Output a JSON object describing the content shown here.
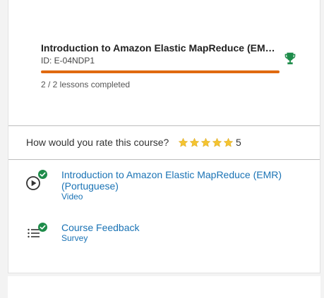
{
  "course": {
    "title": "Introduction to Amazon Elastic MapReduce (EMR) (Portuguese)",
    "id_label": "ID: E-04NDP1",
    "progress_fraction": 1.0,
    "lessons_completed": "2 / 2 lessons completed",
    "trophy_icon": "trophy-icon"
  },
  "rating": {
    "question": "How would you rate this course?",
    "stars": 5,
    "value": "5",
    "star_icon": "star-icon"
  },
  "items": [
    {
      "title": "Introduction to Amazon Elastic MapReduce (EMR) (Portuguese)",
      "type": "Video",
      "icon": "play-circle-icon",
      "completed": true
    },
    {
      "title": "Course Feedback",
      "type": "Survey",
      "icon": "list-icon",
      "completed": true
    }
  ],
  "colors": {
    "accent_orange": "#e06a10",
    "link_blue": "#1a73b5",
    "success_green": "#1e8c4a",
    "star_gold": "#f4c431"
  }
}
